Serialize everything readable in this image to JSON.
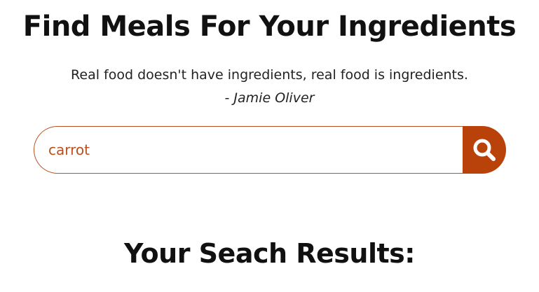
{
  "header": {
    "title": "Find Meals For Your Ingredients",
    "quote": "Real food doesn't have ingredients, real food is ingredients.",
    "quote_author": "- Jamie Oliver"
  },
  "search": {
    "value": "carrot",
    "placeholder": "",
    "button_icon": "search-icon"
  },
  "results": {
    "heading": "Your Seach Results:"
  },
  "colors": {
    "accent": "#b9420a",
    "input_border": "#b9501e",
    "input_text": "#b9501e"
  }
}
